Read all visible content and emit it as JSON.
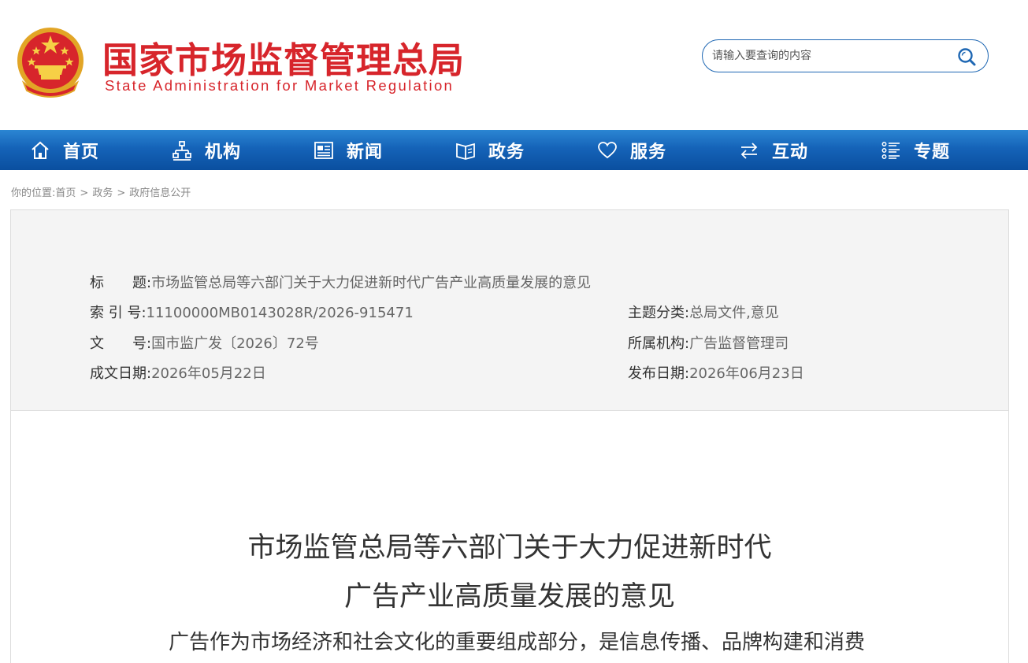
{
  "header": {
    "title_cn": "国家市场监督管理总局",
    "title_en": "State Administration for Market Regulation",
    "search_placeholder": "请输入要查询的内容"
  },
  "nav": {
    "items": [
      {
        "label": "首页",
        "icon": "home-icon"
      },
      {
        "label": "机构",
        "icon": "org-chart-icon"
      },
      {
        "label": "新闻",
        "icon": "news-icon"
      },
      {
        "label": "政务",
        "icon": "book-icon"
      },
      {
        "label": "服务",
        "icon": "heart-icon"
      },
      {
        "label": "互动",
        "icon": "exchange-arrows-icon"
      },
      {
        "label": "专题",
        "icon": "list-icon"
      }
    ]
  },
  "breadcrumb": {
    "prefix": "你的位置:",
    "items": [
      "首页",
      "政务",
      "政府信息公开"
    ],
    "separator": ">"
  },
  "meta": {
    "title_key": "标　　题:",
    "title_val": "市场监管总局等六部门关于大力促进新时代广告产业高质量发展的意见",
    "index_key": "索 引 号:",
    "index_val": "11100000MB0143028R/2026-915471",
    "subject_key": "主题分类:",
    "subject_val": "总局文件,意见",
    "docno_key": "文　　号:",
    "docno_val": "国市监广发〔2026〕72号",
    "agency_key": "所属机构:",
    "agency_val": "广告监督管理司",
    "written_key": "成文日期:",
    "written_val": "2026年05月22日",
    "published_key": "发布日期:",
    "published_val": "2026年06月23日"
  },
  "article": {
    "title_line1": "市场监管总局等六部门关于大力促进新时代",
    "title_line2": "广告产业高质量发展的意见",
    "para1": "广告作为市场经济和社会文化的重要组成部分，是信息传播、品牌构建和消费"
  },
  "colors": {
    "brand_red": "#d7252b",
    "nav_blue": "#1563b8",
    "meta_bg": "#f4f4f4"
  }
}
